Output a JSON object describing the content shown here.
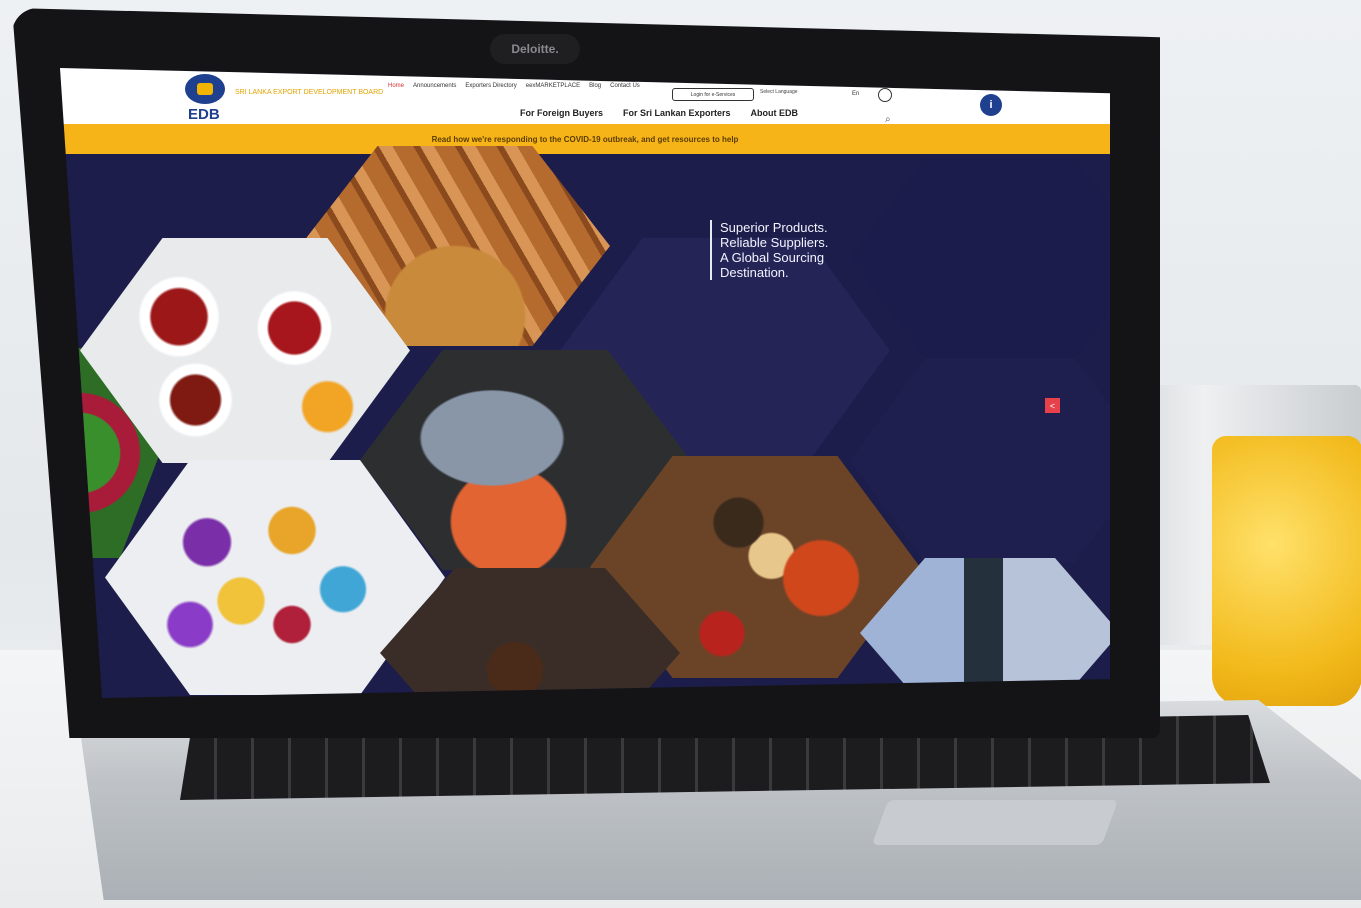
{
  "camera_label": "Deloitte.",
  "brand": {
    "logo_text": "EDB",
    "org_name": "SRI LANKA EXPORT DEVELOPMENT BOARD"
  },
  "top_links": [
    "Home",
    "Announcements",
    "Exporters Directory",
    "eexMARKETPLACE",
    "Blog",
    "Contact Us"
  ],
  "login_button": "Login for e-Services",
  "language_select": "Select Language",
  "language_code": "En",
  "main_nav": [
    "For Foreign Buyers",
    "For Sri Lankan Exporters",
    "About EDB"
  ],
  "covid_banner": "Read how we're responding to the COVID-19 outbreak, and get resources to help",
  "hero": {
    "tagline": [
      "Superior Products.",
      "Reliable Suppliers.",
      "A Global Sourcing",
      "Destination."
    ]
  },
  "icons": {
    "info": "i",
    "search": "search-icon",
    "share": "share-icon"
  },
  "colors": {
    "accent_yellow": "#f6b419",
    "brand_blue": "#1f3f8f",
    "hero_background": "#1c1d4a",
    "share_red": "#e7424b"
  }
}
